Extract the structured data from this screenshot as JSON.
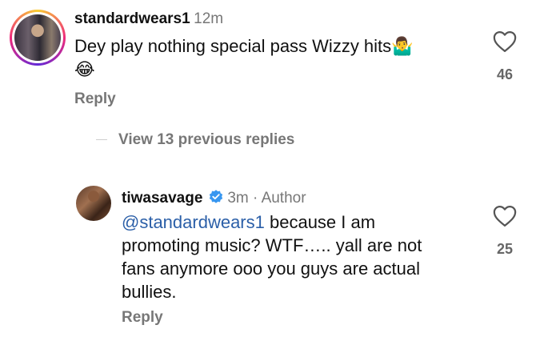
{
  "comment": {
    "username": "standardwears1",
    "time": "12m",
    "text": "Dey play nothing special pass Wizzy hits",
    "emoji_shrug": "🤷‍♂️",
    "emoji_laugh": "😂",
    "reply_label": "Reply",
    "like_count": "46"
  },
  "view_previous_replies": "View 13 previous replies",
  "reply": {
    "username": "tiwasavage",
    "time": "3m",
    "separator": " · ",
    "author_label": "Author",
    "mention": "@standardwears1",
    "text_line1": " because I am",
    "text_line2": "promoting music? WTF….. yall are not",
    "text_line3": "fans anymore ooo you guys are actual",
    "text_line4": "bullies.",
    "reply_label": "Reply",
    "like_count": "25"
  },
  "colors": {
    "verified_badge": "#3897f0",
    "mention": "#2b5fa8"
  },
  "icons": {
    "like": "heart-outline-icon",
    "verified": "verified-badge-icon"
  }
}
